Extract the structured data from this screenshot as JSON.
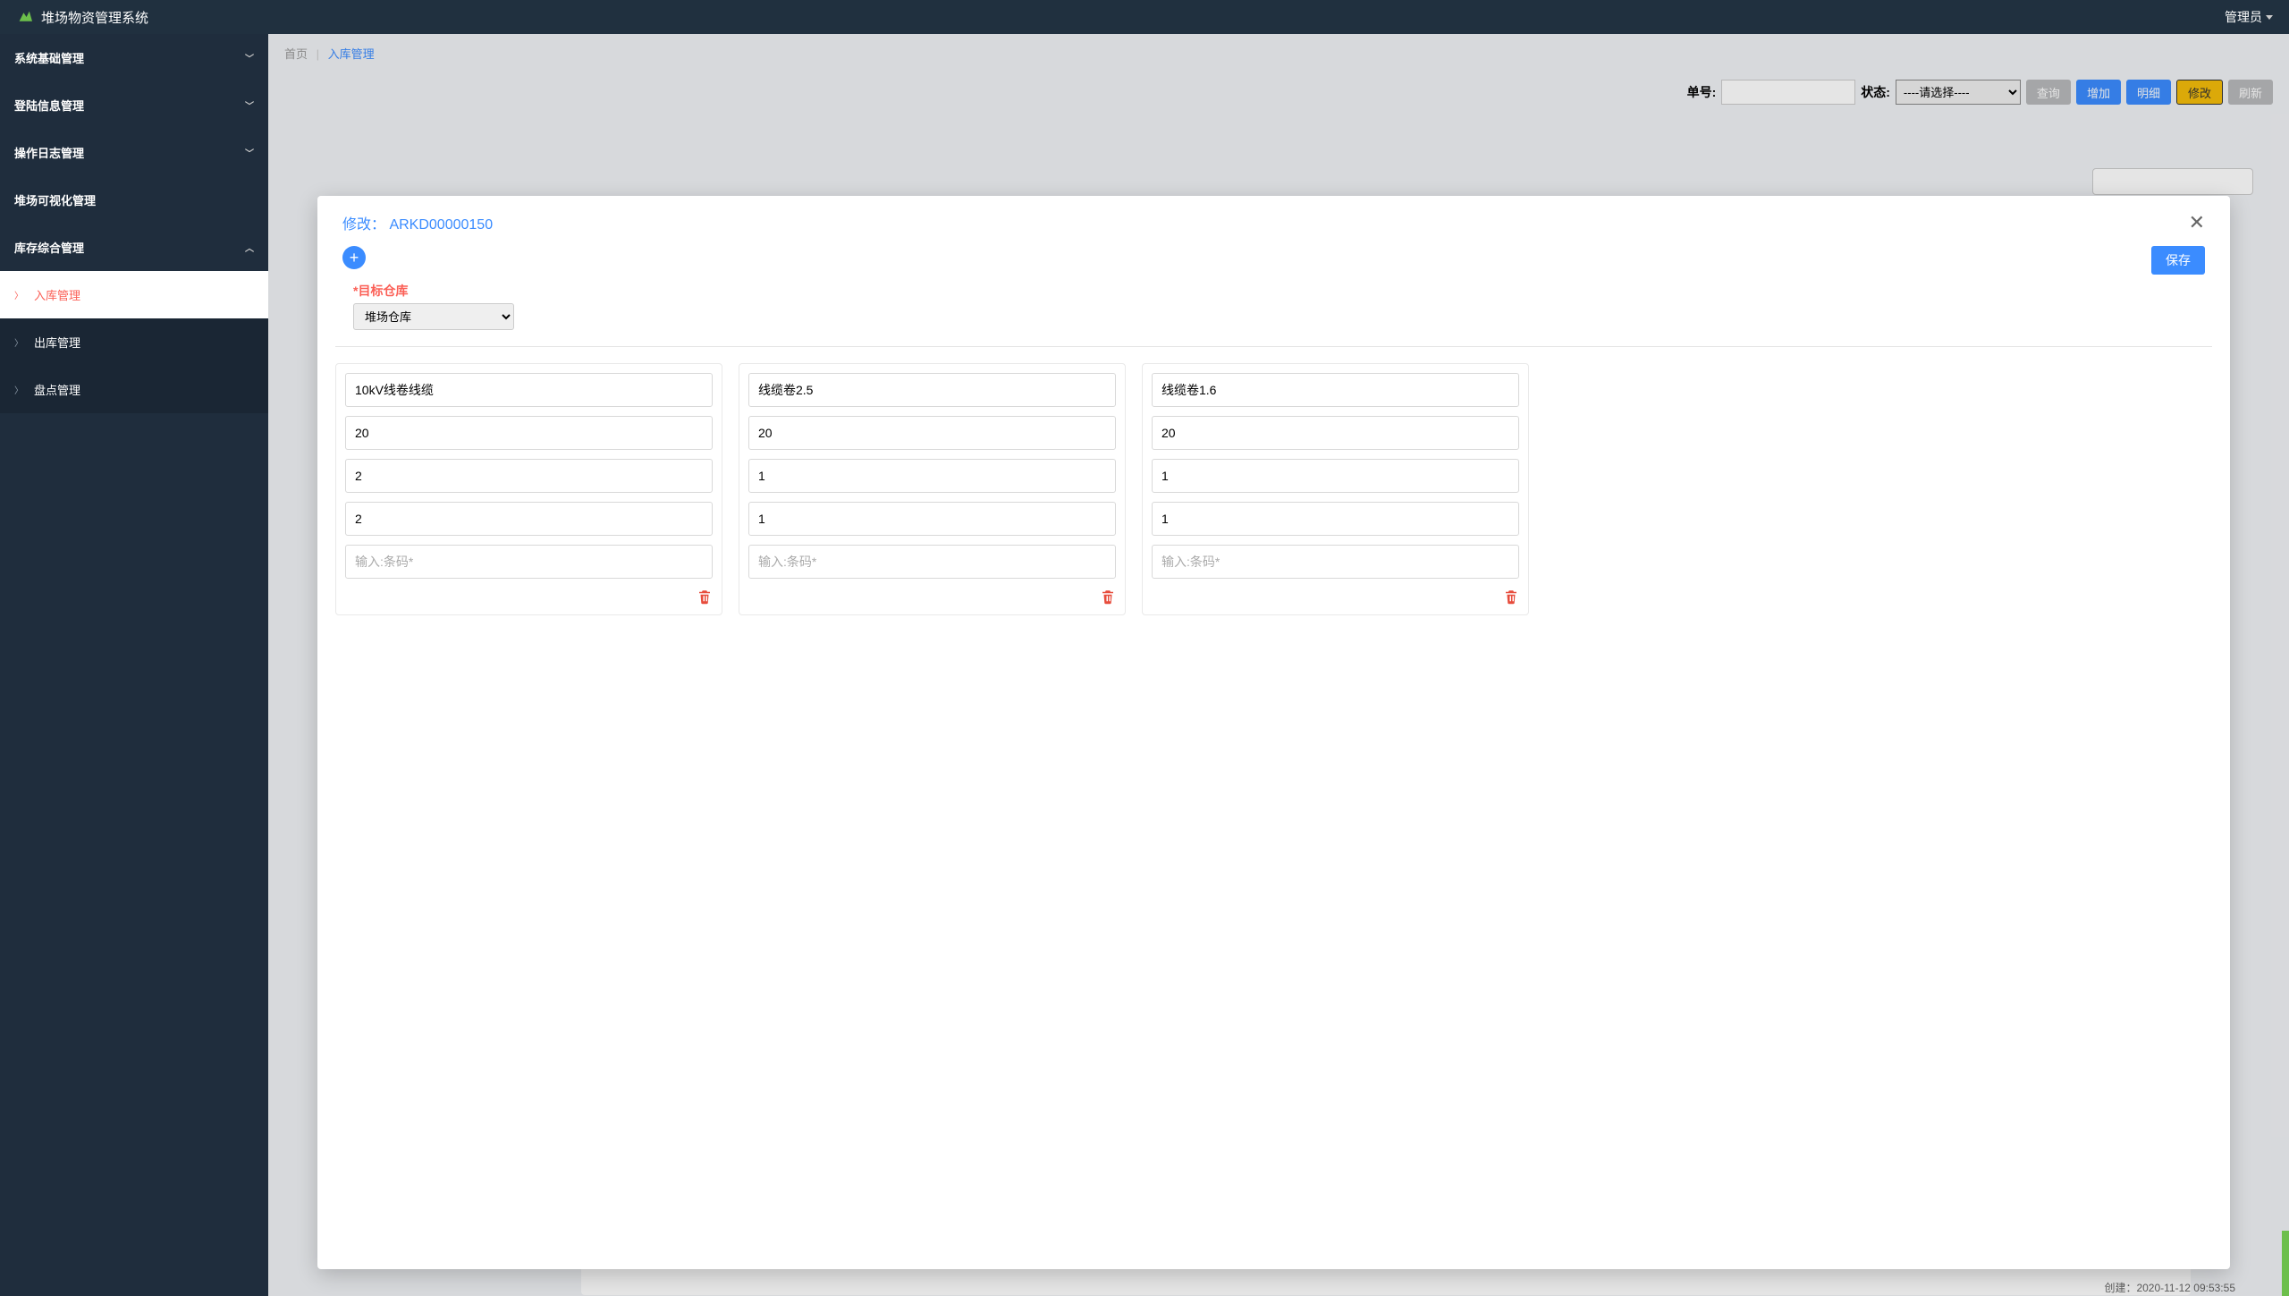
{
  "header": {
    "app_title": "堆场物资管理系统",
    "user_label": "管理员"
  },
  "sidebar": {
    "menus": [
      {
        "label": "系统基础管理",
        "has_children": true,
        "expanded": false
      },
      {
        "label": "登陆信息管理",
        "has_children": true,
        "expanded": false
      },
      {
        "label": "操作日志管理",
        "has_children": true,
        "expanded": false
      },
      {
        "label": "堆场可视化管理",
        "has_children": false,
        "expanded": false
      },
      {
        "label": "库存综合管理",
        "has_children": true,
        "expanded": true
      }
    ],
    "submenu": [
      {
        "label": "入库管理",
        "active": true
      },
      {
        "label": "出库管理",
        "active": false
      },
      {
        "label": "盘点管理",
        "active": false
      }
    ]
  },
  "breadcrumb": {
    "home": "首页",
    "current": "入库管理"
  },
  "filter": {
    "order_label": "单号:",
    "status_label": "状态:",
    "status_placeholder": "----请选择----",
    "btn_query": "查询",
    "btn_add": "增加",
    "btn_detail": "明细",
    "btn_modify": "修改",
    "btn_refresh": "刷新"
  },
  "behind": {
    "created_label": "创建：2020-11-12 09:53:55"
  },
  "modal": {
    "title": "修改： ARKD00000150",
    "save_label": "保存",
    "target_label": "*目标仓库",
    "target_value": "堆场仓库",
    "barcode_placeholder": "输入:条码*",
    "cards": [
      {
        "name": "10kV线卷线缆",
        "f2": "20",
        "f3": "2",
        "f4": "2"
      },
      {
        "name": "线缆卷2.5",
        "f2": "20",
        "f3": "1",
        "f4": "1"
      },
      {
        "name": "线缆卷1.6",
        "f2": "20",
        "f3": "1",
        "f4": "1"
      }
    ]
  }
}
